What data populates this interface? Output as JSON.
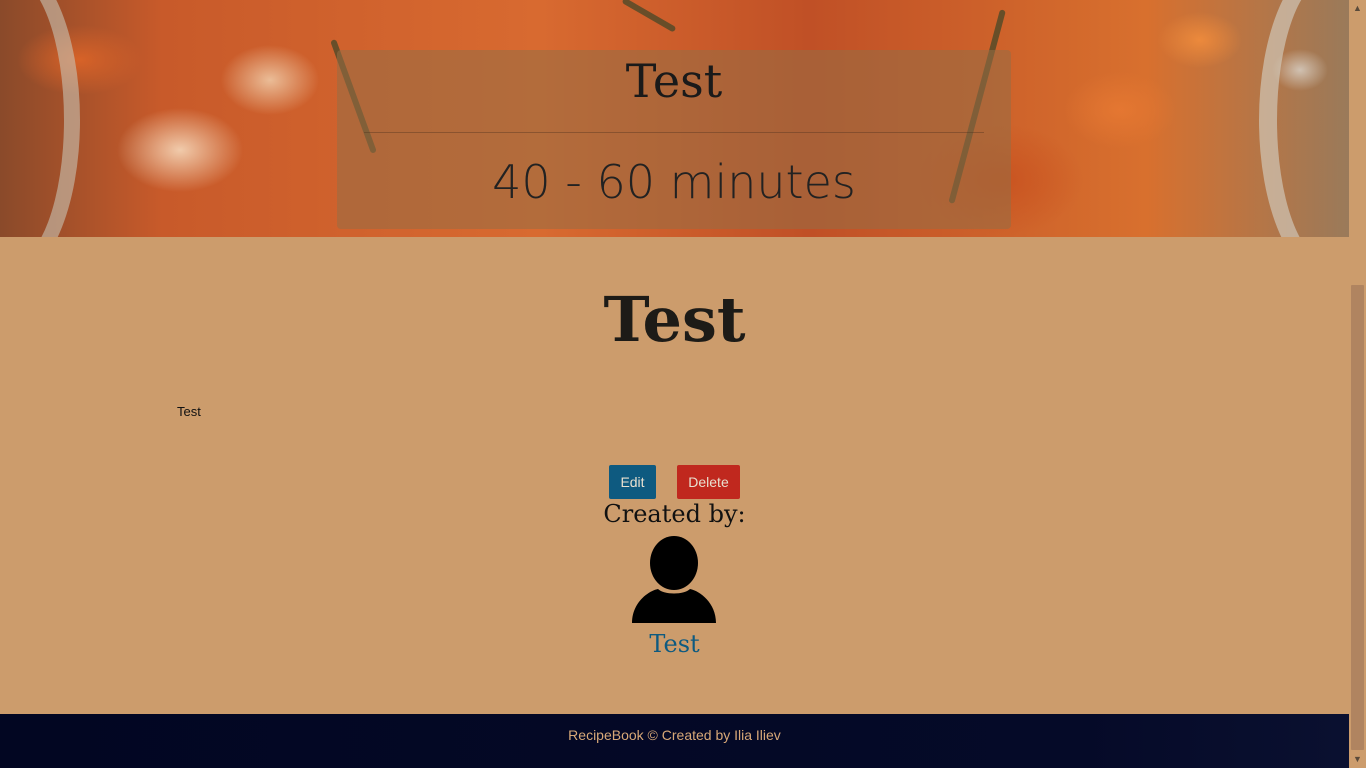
{
  "hero": {
    "title": "Test",
    "time": "40 - 60 minutes"
  },
  "recipe": {
    "title": "Test",
    "description": "Test"
  },
  "actions": {
    "edit_label": "Edit",
    "delete_label": "Delete"
  },
  "author": {
    "created_by_label": "Created by:",
    "name": "Test",
    "avatar_icon": "user-icon"
  },
  "footer": {
    "text": "RecipeBook © Created by Ilia Iliev"
  },
  "colors": {
    "background": "#cc9c6c",
    "edit_button": "#0e5a80",
    "delete_button": "#c0281e",
    "footer": "#020622",
    "link": "#0e5a80"
  }
}
